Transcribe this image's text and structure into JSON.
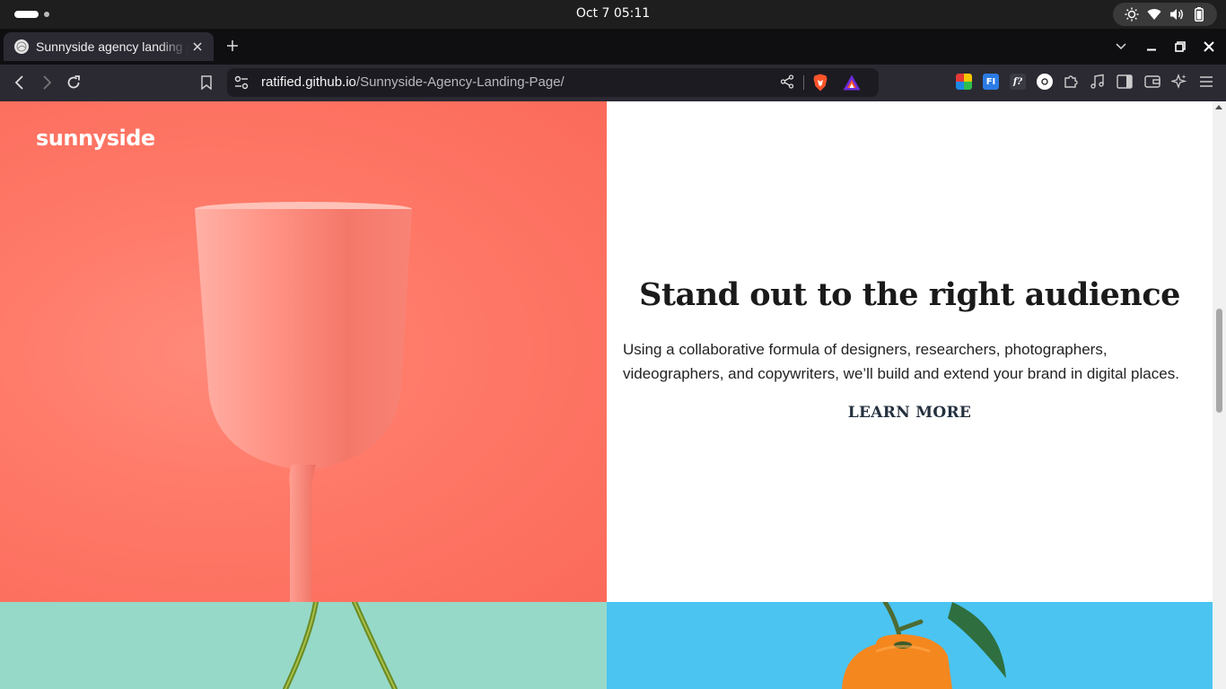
{
  "os": {
    "clock": "Oct 7  05:11",
    "tray_icons": [
      "brightness-icon",
      "wifi-icon",
      "volume-icon",
      "battery-icon"
    ]
  },
  "browser": {
    "tab": {
      "title": "Sunnyside agency landing page"
    },
    "url": {
      "host": "ratified.github.io",
      "path": "/Sunnyside-Agency-Landing-Page/"
    },
    "extensions": [
      "color-picker-ext-icon",
      "fi-ext-icon",
      "fx-ext-icon",
      "circle-ext-icon",
      "puzzle-icon",
      "music-icon",
      "sidebar-icon",
      "wallet-icon",
      "leo-ai-icon",
      "menu-icon"
    ],
    "fi_label": "FI",
    "fx_label": "f?"
  },
  "page": {
    "logo": "sunnyside",
    "heading": "Stand out to the right audience",
    "body": "Using a collaborative formula of designers, researchers, photographers, videographers, and copywriters, we’ll build and extend your brand in digital places.",
    "cta": "LEARN MORE"
  },
  "colors": {
    "hero_bg": "#ff7a69",
    "cta_underline": "#fad400",
    "cherry_bg": "#96d9c9",
    "orange_bg": "#4bc4f1"
  }
}
